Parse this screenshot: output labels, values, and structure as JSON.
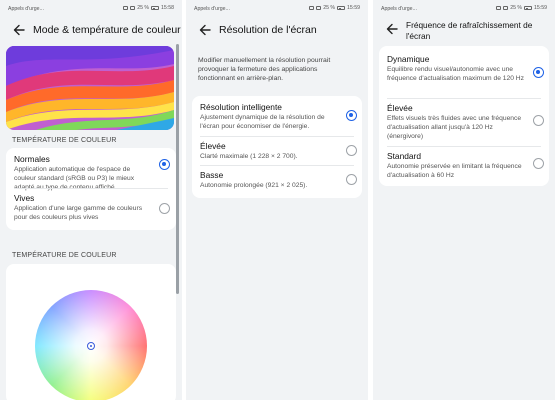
{
  "status": {
    "carrier": "Appels d'urge...",
    "battery1": "25 %",
    "time1": "15:58",
    "battery2": "25 %",
    "time2": "15:59",
    "battery3": "25 %",
    "time3": "15:59"
  },
  "screen1": {
    "title": "Mode & température de couleur",
    "section1": "TEMPÉRATURE DE COULEUR",
    "options": [
      {
        "title": "Normales",
        "desc": "Application automatique de l'espace de couleur standard (sRGB ou P3) le mieux adapté au type de contenu affiché",
        "selected": true
      },
      {
        "title": "Vives",
        "desc": "Application d'une large gamme de couleurs pour des couleurs plus vives",
        "selected": false
      }
    ],
    "section2": "TEMPÉRATURE DE COULEUR"
  },
  "screen2": {
    "title": "Résolution de l'écran",
    "intro": "Modifier manuellement la résolution pourrait provoquer la fermeture des applications fonctionnant en arrière-plan.",
    "options": [
      {
        "title": "Résolution intelligente",
        "desc": "Ajustement dynamique de la résolution de l'écran pour économiser de l'énergie.",
        "selected": true
      },
      {
        "title": "Élevée",
        "desc": "Clarté maximale (1 228 × 2 700).",
        "selected": false
      },
      {
        "title": "Basse",
        "desc": "Autonomie prolongée (921 × 2 025).",
        "selected": false
      }
    ]
  },
  "screen3": {
    "title": "Fréquence de rafraîchissement de l'écran",
    "options": [
      {
        "title": "Dynamique",
        "desc": "Equilibre rendu visuel/autonomie avec une fréquence d'actualisation maximum de 120 Hz",
        "selected": true
      },
      {
        "title": "Élevée",
        "desc": "Effets visuels très fluides avec une fréquence d'actualisation allant jusqu'à 120 Hz (énergivore)",
        "selected": false
      },
      {
        "title": "Standard",
        "desc": "Autonomie préservée en limitant la fréquence d'actualisation à 60 Hz",
        "selected": false
      }
    ]
  },
  "colors": {
    "accent": "#1f62e6",
    "background": "#f1f3f5",
    "card": "#ffffff"
  },
  "icons": [
    "back-arrow-icon",
    "signal-icon",
    "wifi-icon",
    "battery-icon"
  ]
}
